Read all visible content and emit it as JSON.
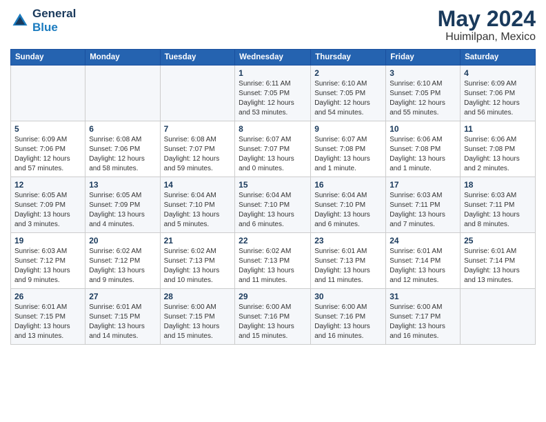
{
  "logo": {
    "line1": "General",
    "line2": "Blue"
  },
  "header": {
    "month": "May 2024",
    "location": "Huimilpan, Mexico"
  },
  "weekdays": [
    "Sunday",
    "Monday",
    "Tuesday",
    "Wednesday",
    "Thursday",
    "Friday",
    "Saturday"
  ],
  "weeks": [
    [
      {
        "day": "",
        "sunrise": "",
        "sunset": "",
        "daylight": ""
      },
      {
        "day": "",
        "sunrise": "",
        "sunset": "",
        "daylight": ""
      },
      {
        "day": "",
        "sunrise": "",
        "sunset": "",
        "daylight": ""
      },
      {
        "day": "1",
        "sunrise": "Sunrise: 6:11 AM",
        "sunset": "Sunset: 7:05 PM",
        "daylight": "Daylight: 12 hours and 53 minutes."
      },
      {
        "day": "2",
        "sunrise": "Sunrise: 6:10 AM",
        "sunset": "Sunset: 7:05 PM",
        "daylight": "Daylight: 12 hours and 54 minutes."
      },
      {
        "day": "3",
        "sunrise": "Sunrise: 6:10 AM",
        "sunset": "Sunset: 7:05 PM",
        "daylight": "Daylight: 12 hours and 55 minutes."
      },
      {
        "day": "4",
        "sunrise": "Sunrise: 6:09 AM",
        "sunset": "Sunset: 7:06 PM",
        "daylight": "Daylight: 12 hours and 56 minutes."
      }
    ],
    [
      {
        "day": "5",
        "sunrise": "Sunrise: 6:09 AM",
        "sunset": "Sunset: 7:06 PM",
        "daylight": "Daylight: 12 hours and 57 minutes."
      },
      {
        "day": "6",
        "sunrise": "Sunrise: 6:08 AM",
        "sunset": "Sunset: 7:06 PM",
        "daylight": "Daylight: 12 hours and 58 minutes."
      },
      {
        "day": "7",
        "sunrise": "Sunrise: 6:08 AM",
        "sunset": "Sunset: 7:07 PM",
        "daylight": "Daylight: 12 hours and 59 minutes."
      },
      {
        "day": "8",
        "sunrise": "Sunrise: 6:07 AM",
        "sunset": "Sunset: 7:07 PM",
        "daylight": "Daylight: 13 hours and 0 minutes."
      },
      {
        "day": "9",
        "sunrise": "Sunrise: 6:07 AM",
        "sunset": "Sunset: 7:08 PM",
        "daylight": "Daylight: 13 hours and 1 minute."
      },
      {
        "day": "10",
        "sunrise": "Sunrise: 6:06 AM",
        "sunset": "Sunset: 7:08 PM",
        "daylight": "Daylight: 13 hours and 1 minute."
      },
      {
        "day": "11",
        "sunrise": "Sunrise: 6:06 AM",
        "sunset": "Sunset: 7:08 PM",
        "daylight": "Daylight: 13 hours and 2 minutes."
      }
    ],
    [
      {
        "day": "12",
        "sunrise": "Sunrise: 6:05 AM",
        "sunset": "Sunset: 7:09 PM",
        "daylight": "Daylight: 13 hours and 3 minutes."
      },
      {
        "day": "13",
        "sunrise": "Sunrise: 6:05 AM",
        "sunset": "Sunset: 7:09 PM",
        "daylight": "Daylight: 13 hours and 4 minutes."
      },
      {
        "day": "14",
        "sunrise": "Sunrise: 6:04 AM",
        "sunset": "Sunset: 7:10 PM",
        "daylight": "Daylight: 13 hours and 5 minutes."
      },
      {
        "day": "15",
        "sunrise": "Sunrise: 6:04 AM",
        "sunset": "Sunset: 7:10 PM",
        "daylight": "Daylight: 13 hours and 6 minutes."
      },
      {
        "day": "16",
        "sunrise": "Sunrise: 6:04 AM",
        "sunset": "Sunset: 7:10 PM",
        "daylight": "Daylight: 13 hours and 6 minutes."
      },
      {
        "day": "17",
        "sunrise": "Sunrise: 6:03 AM",
        "sunset": "Sunset: 7:11 PM",
        "daylight": "Daylight: 13 hours and 7 minutes."
      },
      {
        "day": "18",
        "sunrise": "Sunrise: 6:03 AM",
        "sunset": "Sunset: 7:11 PM",
        "daylight": "Daylight: 13 hours and 8 minutes."
      }
    ],
    [
      {
        "day": "19",
        "sunrise": "Sunrise: 6:03 AM",
        "sunset": "Sunset: 7:12 PM",
        "daylight": "Daylight: 13 hours and 9 minutes."
      },
      {
        "day": "20",
        "sunrise": "Sunrise: 6:02 AM",
        "sunset": "Sunset: 7:12 PM",
        "daylight": "Daylight: 13 hours and 9 minutes."
      },
      {
        "day": "21",
        "sunrise": "Sunrise: 6:02 AM",
        "sunset": "Sunset: 7:13 PM",
        "daylight": "Daylight: 13 hours and 10 minutes."
      },
      {
        "day": "22",
        "sunrise": "Sunrise: 6:02 AM",
        "sunset": "Sunset: 7:13 PM",
        "daylight": "Daylight: 13 hours and 11 minutes."
      },
      {
        "day": "23",
        "sunrise": "Sunrise: 6:01 AM",
        "sunset": "Sunset: 7:13 PM",
        "daylight": "Daylight: 13 hours and 11 minutes."
      },
      {
        "day": "24",
        "sunrise": "Sunrise: 6:01 AM",
        "sunset": "Sunset: 7:14 PM",
        "daylight": "Daylight: 13 hours and 12 minutes."
      },
      {
        "day": "25",
        "sunrise": "Sunrise: 6:01 AM",
        "sunset": "Sunset: 7:14 PM",
        "daylight": "Daylight: 13 hours and 13 minutes."
      }
    ],
    [
      {
        "day": "26",
        "sunrise": "Sunrise: 6:01 AM",
        "sunset": "Sunset: 7:15 PM",
        "daylight": "Daylight: 13 hours and 13 minutes."
      },
      {
        "day": "27",
        "sunrise": "Sunrise: 6:01 AM",
        "sunset": "Sunset: 7:15 PM",
        "daylight": "Daylight: 13 hours and 14 minutes."
      },
      {
        "day": "28",
        "sunrise": "Sunrise: 6:00 AM",
        "sunset": "Sunset: 7:15 PM",
        "daylight": "Daylight: 13 hours and 15 minutes."
      },
      {
        "day": "29",
        "sunrise": "Sunrise: 6:00 AM",
        "sunset": "Sunset: 7:16 PM",
        "daylight": "Daylight: 13 hours and 15 minutes."
      },
      {
        "day": "30",
        "sunrise": "Sunrise: 6:00 AM",
        "sunset": "Sunset: 7:16 PM",
        "daylight": "Daylight: 13 hours and 16 minutes."
      },
      {
        "day": "31",
        "sunrise": "Sunrise: 6:00 AM",
        "sunset": "Sunset: 7:17 PM",
        "daylight": "Daylight: 13 hours and 16 minutes."
      },
      {
        "day": "",
        "sunrise": "",
        "sunset": "",
        "daylight": ""
      }
    ]
  ]
}
